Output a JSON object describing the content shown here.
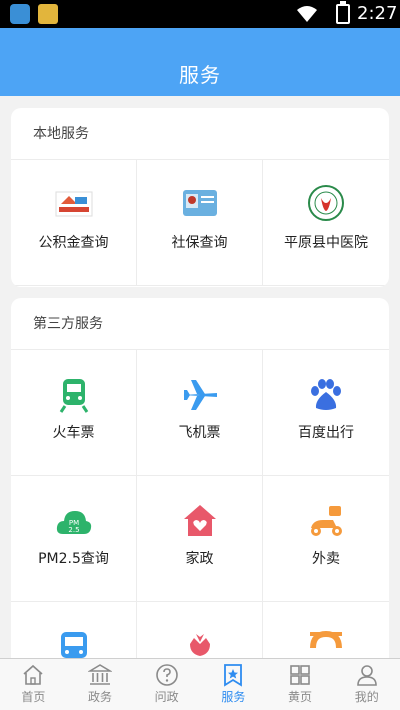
{
  "status_bar": {
    "time": "2:27"
  },
  "header": {
    "title": "服务"
  },
  "local_section": {
    "title": "本地服务",
    "items": [
      {
        "label": "公积金查询",
        "icon": "housing-fund-icon"
      },
      {
        "label": "社保查询",
        "icon": "social-security-card-icon"
      },
      {
        "label": "平原县中医院",
        "icon": "hospital-logo-icon"
      }
    ]
  },
  "third_section": {
    "title": "第三方服务",
    "items": [
      {
        "label": "火车票",
        "icon": "train-icon",
        "color": "#2db36b"
      },
      {
        "label": "飞机票",
        "icon": "airplane-icon",
        "color": "#3a9bef"
      },
      {
        "label": "百度出行",
        "icon": "baidu-paw-icon",
        "color": "#3a6fe0"
      },
      {
        "label": "PM2.5查询",
        "icon": "pm25-cloud-icon",
        "color": "#2db36b"
      },
      {
        "label": "家政",
        "icon": "home-heart-icon",
        "color": "#e8586a"
      },
      {
        "label": "外卖",
        "icon": "scooter-icon",
        "color": "#f59a3c"
      },
      {
        "label": "",
        "icon": "bus-icon",
        "color": "#3a9bef"
      },
      {
        "label": "",
        "icon": "flower-icon",
        "color": "#e8586a"
      },
      {
        "label": "",
        "icon": "didi-icon",
        "color": "#f59a3c"
      }
    ]
  },
  "tab_bar": {
    "items": [
      {
        "label": "首页",
        "icon": "home-icon"
      },
      {
        "label": "政务",
        "icon": "government-icon"
      },
      {
        "label": "问政",
        "icon": "question-icon"
      },
      {
        "label": "服务",
        "icon": "service-star-icon",
        "active": true
      },
      {
        "label": "黄页",
        "icon": "grid-icon"
      },
      {
        "label": "我的",
        "icon": "user-icon"
      }
    ],
    "active_color": "#2e8cf0",
    "inactive_color": "#8a8a8a"
  }
}
